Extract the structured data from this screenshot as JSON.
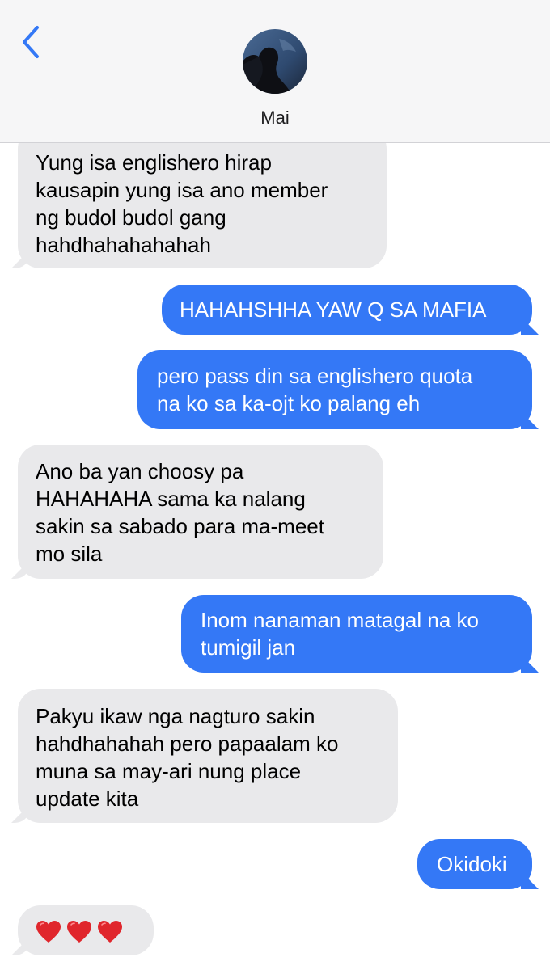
{
  "header": {
    "contact_name": "Mai",
    "back_icon": "chevron-left-icon"
  },
  "colors": {
    "incoming_bubble": "#e9e9eb",
    "outgoing_bubble": "#3478f6",
    "accent": "#3478f6",
    "heart": "#e0262c"
  },
  "messages": [
    {
      "direction": "incoming",
      "lines": [
        "Yung isa englishero hirap",
        "kausapin yung isa ano member",
        "ng budol budol gang",
        "hahdhahahahahah"
      ]
    },
    {
      "direction": "outgoing",
      "lines": [
        "HAHAHSHHA YAW Q SA MAFIA"
      ]
    },
    {
      "direction": "outgoing",
      "lines": [
        "pero pass din sa englishero quota",
        "na ko sa ka-ojt ko palang eh"
      ]
    },
    {
      "direction": "incoming",
      "lines": [
        "Ano ba yan choosy pa",
        "HAHAHAHA sama ka nalang",
        "sakin sa sabado para ma-meet",
        "mo sila"
      ]
    },
    {
      "direction": "outgoing",
      "lines": [
        "Inom nanaman matagal na ko",
        "tumigil jan"
      ]
    },
    {
      "direction": "incoming",
      "lines": [
        "Pakyu ikaw nga nagturo sakin",
        "hahdhahahah pero papaalam ko",
        "muna sa may-ari nung place",
        "update kita"
      ]
    },
    {
      "direction": "outgoing",
      "lines": [
        "Okidoki"
      ]
    },
    {
      "direction": "incoming",
      "emoji": [
        "red-heart-icon",
        "red-heart-icon",
        "red-heart-icon"
      ]
    }
  ]
}
